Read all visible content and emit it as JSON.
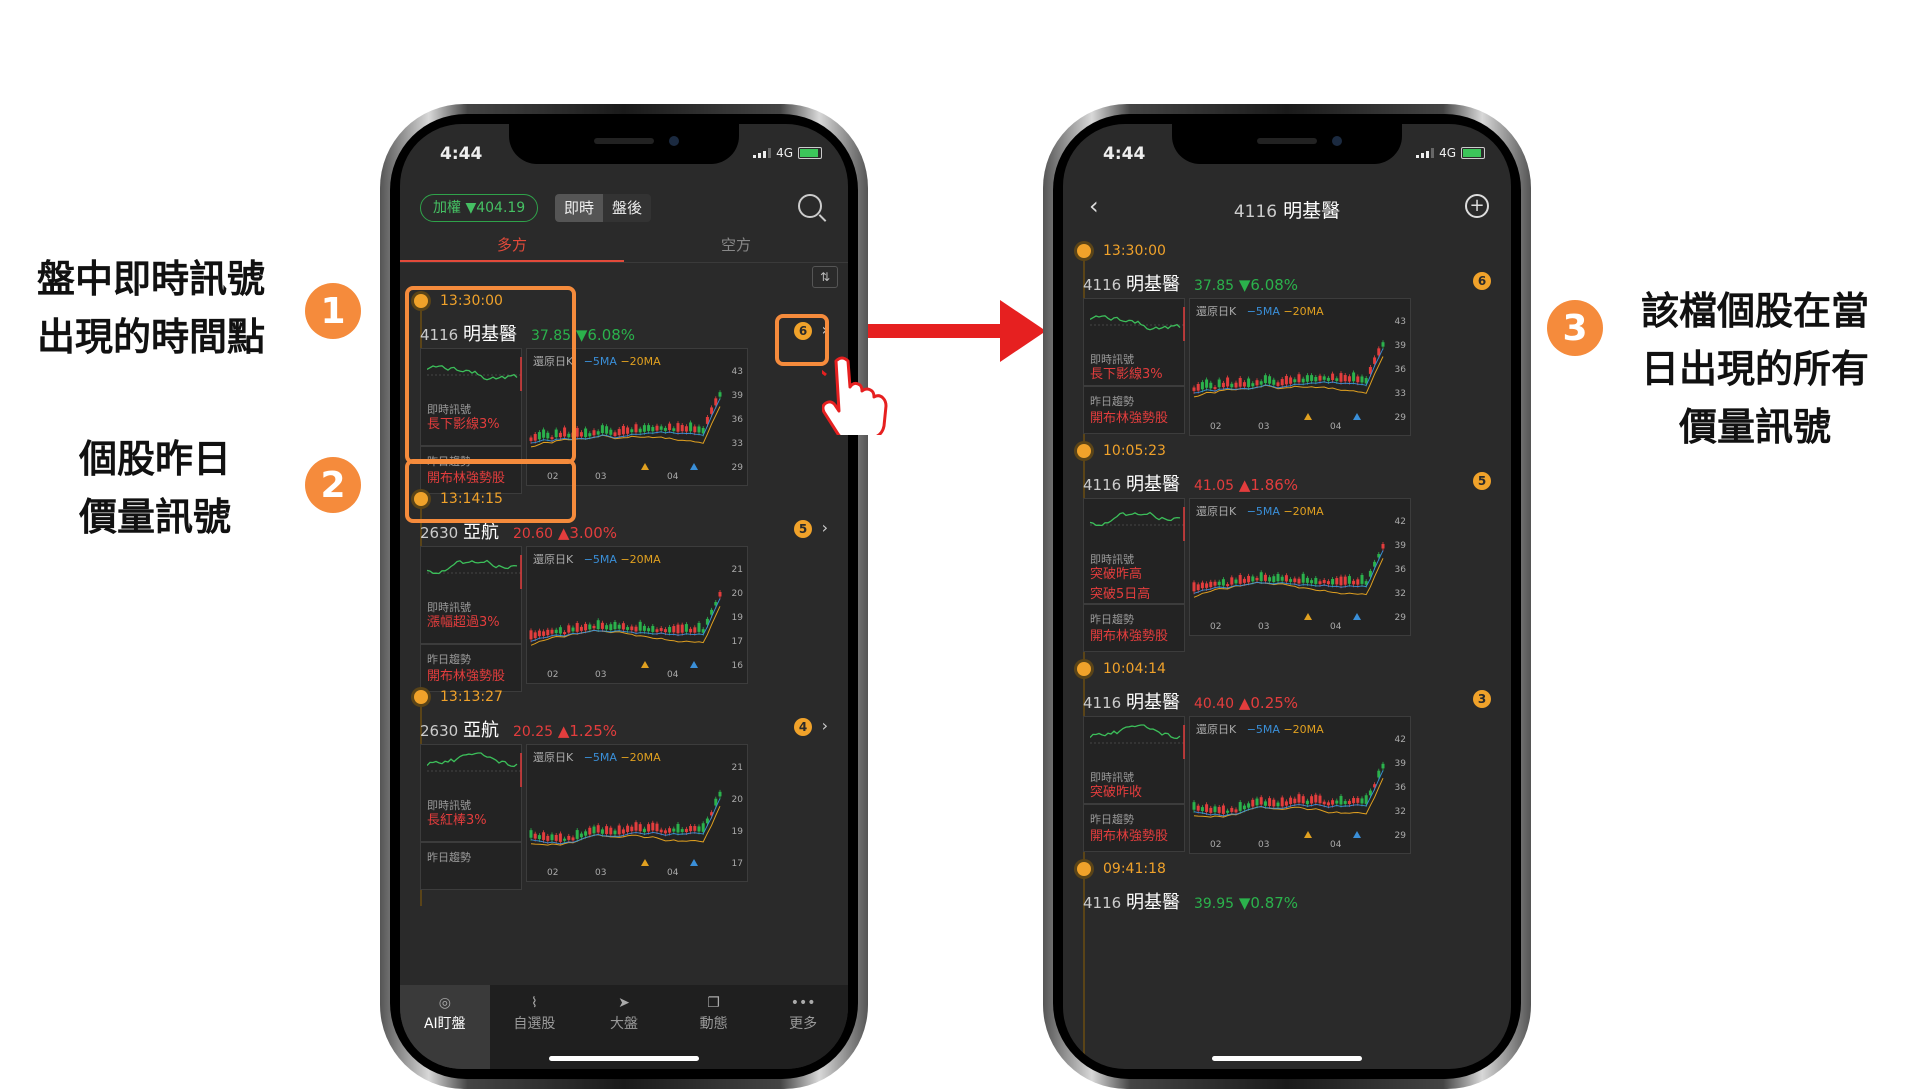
{
  "annotations": {
    "label1": "盤中即時訊號\n出現的時間點",
    "label2": "個股昨日\n價量訊號",
    "label3": "該檔個股在當\n日出現的所有\n價量訊號",
    "badge1": "1",
    "badge2": "2",
    "badge3": "3"
  },
  "colors": {
    "accent": "#f58b3c",
    "up": "#e33d3d",
    "down": "#2bb24c",
    "timeline": "#f0a22a"
  },
  "left_phone": {
    "time": "4:44",
    "network": "4G",
    "index_pill": "加權 ▼404.19",
    "seg_live": "即時",
    "seg_after": "盤後",
    "tab_long": "多方",
    "tab_short": "空方",
    "cards": [
      {
        "time": "13:30:00",
        "code": "4116",
        "name": "明基醫",
        "price": "37.85",
        "change": "▼6.08%",
        "dir": "dn",
        "count": "6",
        "live_label": "即時訊號",
        "signals": [
          "長下影線3%"
        ],
        "trend_label": "昨日趨勢",
        "trend": "開布林強勢股",
        "k_title": "還原日K",
        "ma5": "−5MA",
        "ma20": "−20MA",
        "yticks": [
          "43",
          "39",
          "36",
          "33",
          "29"
        ],
        "xticks": [
          "02",
          "03",
          "04"
        ]
      },
      {
        "time": "13:14:15",
        "code": "2630",
        "name": "亞航",
        "price": "20.60",
        "change": "▲3.00%",
        "dir": "up",
        "count": "5",
        "live_label": "即時訊號",
        "signals": [
          "漲幅超過3%"
        ],
        "trend_label": "昨日趨勢",
        "trend": "開布林強勢股",
        "k_title": "還原日K",
        "ma5": "−5MA",
        "ma20": "−20MA",
        "yticks": [
          "21",
          "20",
          "19",
          "17",
          "16"
        ],
        "xticks": [
          "02",
          "03",
          "04"
        ]
      },
      {
        "time": "13:13:27",
        "code": "2630",
        "name": "亞航",
        "price": "20.25",
        "change": "▲1.25%",
        "dir": "up",
        "count": "4",
        "live_label": "即時訊號",
        "signals": [
          "長紅棒3%"
        ],
        "trend_label": "昨日趨勢",
        "trend": "",
        "k_title": "還原日K",
        "ma5": "−5MA",
        "ma20": "−20MA",
        "yticks": [
          "21",
          "20",
          "19",
          "17"
        ],
        "xticks": [
          "02",
          "03",
          "04"
        ]
      }
    ],
    "nav": [
      {
        "label": "AI盯盤",
        "icon": "eye-icon"
      },
      {
        "label": "自選股",
        "icon": "chart-icon"
      },
      {
        "label": "大盤",
        "icon": "navigate-icon"
      },
      {
        "label": "動態",
        "icon": "copy-icon"
      },
      {
        "label": "更多",
        "icon": "more-icon"
      }
    ]
  },
  "right_phone": {
    "time": "4:44",
    "network": "4G",
    "title_code": "4116",
    "title_name": "明基醫",
    "cards": [
      {
        "time": "13:30:00",
        "code": "4116",
        "name": "明基醫",
        "price": "37.85",
        "change": "▼6.08%",
        "dir": "dn",
        "count": "6",
        "live_label": "即時訊號",
        "signals": [
          "長下影線3%"
        ],
        "trend_label": "昨日趨勢",
        "trend": "開布林強勢股",
        "k_title": "還原日K",
        "ma5": "−5MA",
        "ma20": "−20MA",
        "yticks": [
          "43",
          "39",
          "36",
          "33",
          "29"
        ],
        "xticks": [
          "02",
          "03",
          "04"
        ]
      },
      {
        "time": "10:05:23",
        "code": "4116",
        "name": "明基醫",
        "price": "41.05",
        "change": "▲1.86%",
        "dir": "up",
        "count": "5",
        "live_label": "即時訊號",
        "signals": [
          "突破昨高",
          "突破5日高"
        ],
        "trend_label": "昨日趨勢",
        "trend": "開布林強勢股",
        "k_title": "還原日K",
        "ma5": "−5MA",
        "ma20": "−20MA",
        "yticks": [
          "42",
          "39",
          "36",
          "32",
          "29"
        ],
        "xticks": [
          "02",
          "03",
          "04"
        ]
      },
      {
        "time": "10:04:14",
        "code": "4116",
        "name": "明基醫",
        "price": "40.40",
        "change": "▲0.25%",
        "dir": "up",
        "count": "3",
        "live_label": "即時訊號",
        "signals": [
          "突破昨收"
        ],
        "trend_label": "昨日趨勢",
        "trend": "開布林強勢股",
        "k_title": "還原日K",
        "ma5": "−5MA",
        "ma20": "−20MA",
        "yticks": [
          "42",
          "39",
          "36",
          "32",
          "29"
        ],
        "xticks": [
          "02",
          "03",
          "04"
        ]
      },
      {
        "time": "09:41:18",
        "code": "4116",
        "name": "明基醫",
        "price": "39.95",
        "change": "▼0.87%",
        "dir": "dn",
        "count": "",
        "live_label": "",
        "signals": [],
        "trend_label": "",
        "trend": "",
        "k_title": "",
        "ma5": "",
        "ma20": "",
        "yticks": [],
        "xticks": []
      }
    ]
  }
}
